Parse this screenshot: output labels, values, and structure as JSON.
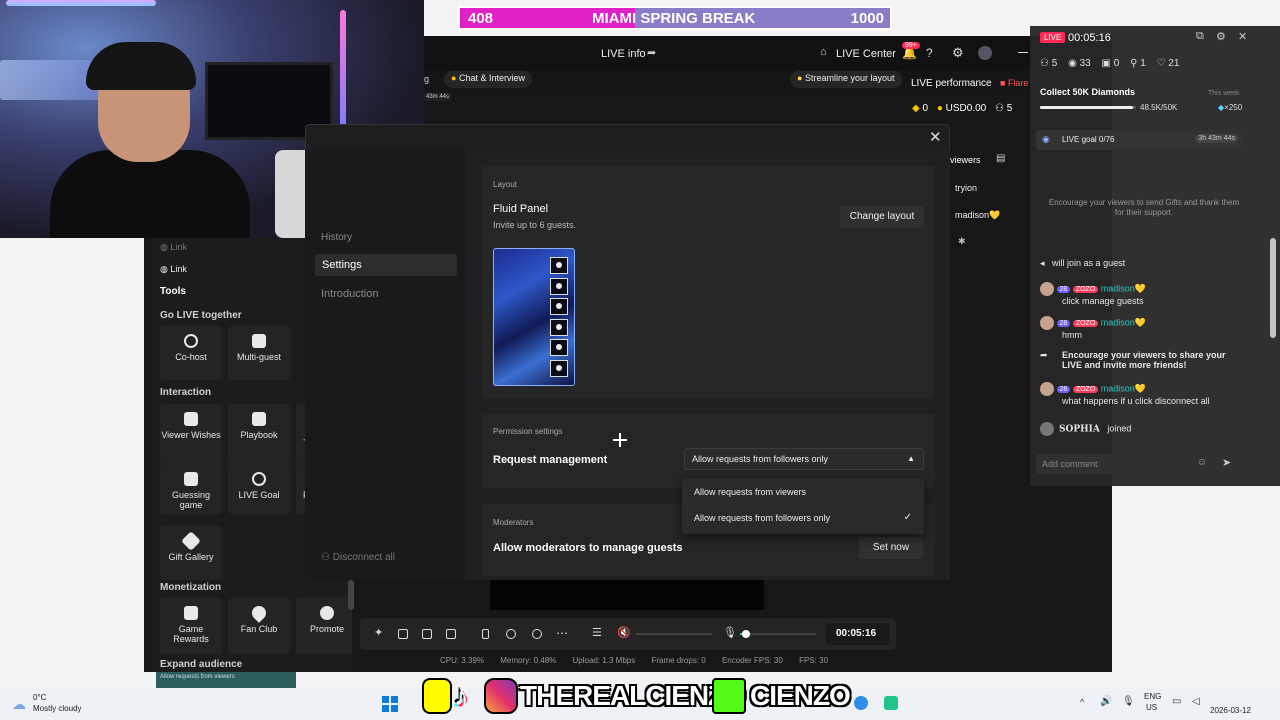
{
  "overlay": {
    "left_count": "408",
    "title": "MIAMI SPRING BREAK",
    "right_count": "1000",
    "progress": 0.408
  },
  "topbar": {
    "live_info": "LIVE info",
    "live_center": "LIVE Center",
    "notif_badge": "99+",
    "tabs_partial": "g",
    "chat_interview": "Chat & Interview",
    "streamline": "Streamline your layout",
    "live_performance": "LIVE performance",
    "flare": "Flare",
    "timer_small": "43m 44s",
    "diamonds": "0",
    "usd": "USD0.00",
    "viewers_count": "5"
  },
  "viewers_panel": {
    "tab": "viewers",
    "names": [
      "tryion",
      "madison💛"
    ]
  },
  "tools": {
    "link_top": "Link",
    "link": "Link",
    "title": "Tools",
    "section_go_live": "Go LIVE together",
    "cohost": "Co-host",
    "multiguest": "Multi-guest",
    "section_interaction": "Interaction",
    "viewer_wishes": "Viewer Wishes",
    "playbook": "Playbook",
    "guessing_game": "Guessing game",
    "live_goal": "LIVE Goal",
    "gift_gallery": "Gift Gallery",
    "section_monetization": "Monetization",
    "game_rewards": "Game Rewards",
    "fan_club": "Fan Club",
    "promote": "Promote",
    "expand_audience": "Expand audience",
    "partial_t": "T",
    "partial_p": "P",
    "bottom_thumb_text": "Allow requests from viewers"
  },
  "modal": {
    "nav_history": "History",
    "nav_settings": "Settings",
    "nav_introduction": "Introduction",
    "disconnect_all": "Disconnect all",
    "layout_label": "Layout",
    "layout_name": "Fluid Panel",
    "layout_desc": "Invite up to 6 guests.",
    "change_layout": "Change layout",
    "permission_label": "Permission settings",
    "request_management": "Request management",
    "dropdown_selected": "Allow requests from followers only",
    "dropdown_options": [
      "Allow requests from viewers",
      "Allow requests from followers only"
    ],
    "moderators_label": "Moderators",
    "moderators_text": "Allow moderators to manage guests",
    "set_now": "Set now"
  },
  "right_panel": {
    "live_badge": "LIVE",
    "timer": "00:05:16",
    "stats": {
      "guests": "5",
      "views": "33",
      "gifts": "0",
      "followers": "1",
      "likes": "21"
    },
    "collect_title": "Collect 50K Diamonds",
    "this_week": "This week",
    "collect_progress_text": "48.5K/50K",
    "collect_multiplier": "×250",
    "collect_progress": 0.97,
    "live_goal": "LIVE goal 0/76",
    "live_goal_time": "3h 43m 44s",
    "encourage_gifts": "Encourage your viewers to send Gifts and thank them for their support.",
    "chat": [
      {
        "kind": "system",
        "text": "will join as a guest"
      },
      {
        "kind": "user",
        "level": "28",
        "tag": "ZOZO",
        "name": "madison💛",
        "text": "click manage guests"
      },
      {
        "kind": "user",
        "level": "28",
        "tag": "ZOZO",
        "name": "madison💛",
        "text": "hmm"
      },
      {
        "kind": "system",
        "text": "Encourage your viewers to share your LIVE and invite more friends!"
      },
      {
        "kind": "user",
        "level": "28",
        "tag": "ZOZO",
        "name": "madison💛",
        "text": "what happens if u click disconnect all"
      },
      {
        "kind": "join",
        "name": "SOPHIA",
        "text": "joined"
      }
    ],
    "add_comment": "Add comment"
  },
  "controls": {
    "timer": "00:05:16",
    "perf": {
      "cpu": "CPU: 3.39%",
      "memory": "Memory: 0.48%",
      "upload": "Upload: 1.3 Mbps",
      "drops": "Frame drops: 0",
      "encoder": "Encoder FPS: 30",
      "fps": "FPS: 30"
    }
  },
  "taskbar": {
    "weather_temp": "0°C",
    "weather_desc": "Mostly cloudy",
    "lang": "ENG",
    "region": "US",
    "date": "2026-03-12"
  },
  "social": {
    "handle1": "THEREALCIENZO",
    "handle2": "CIENZO"
  },
  "colors": {
    "accent_pink": "#e021c5",
    "live_red": "#ff2b55",
    "teal": "#2ac9c4"
  }
}
